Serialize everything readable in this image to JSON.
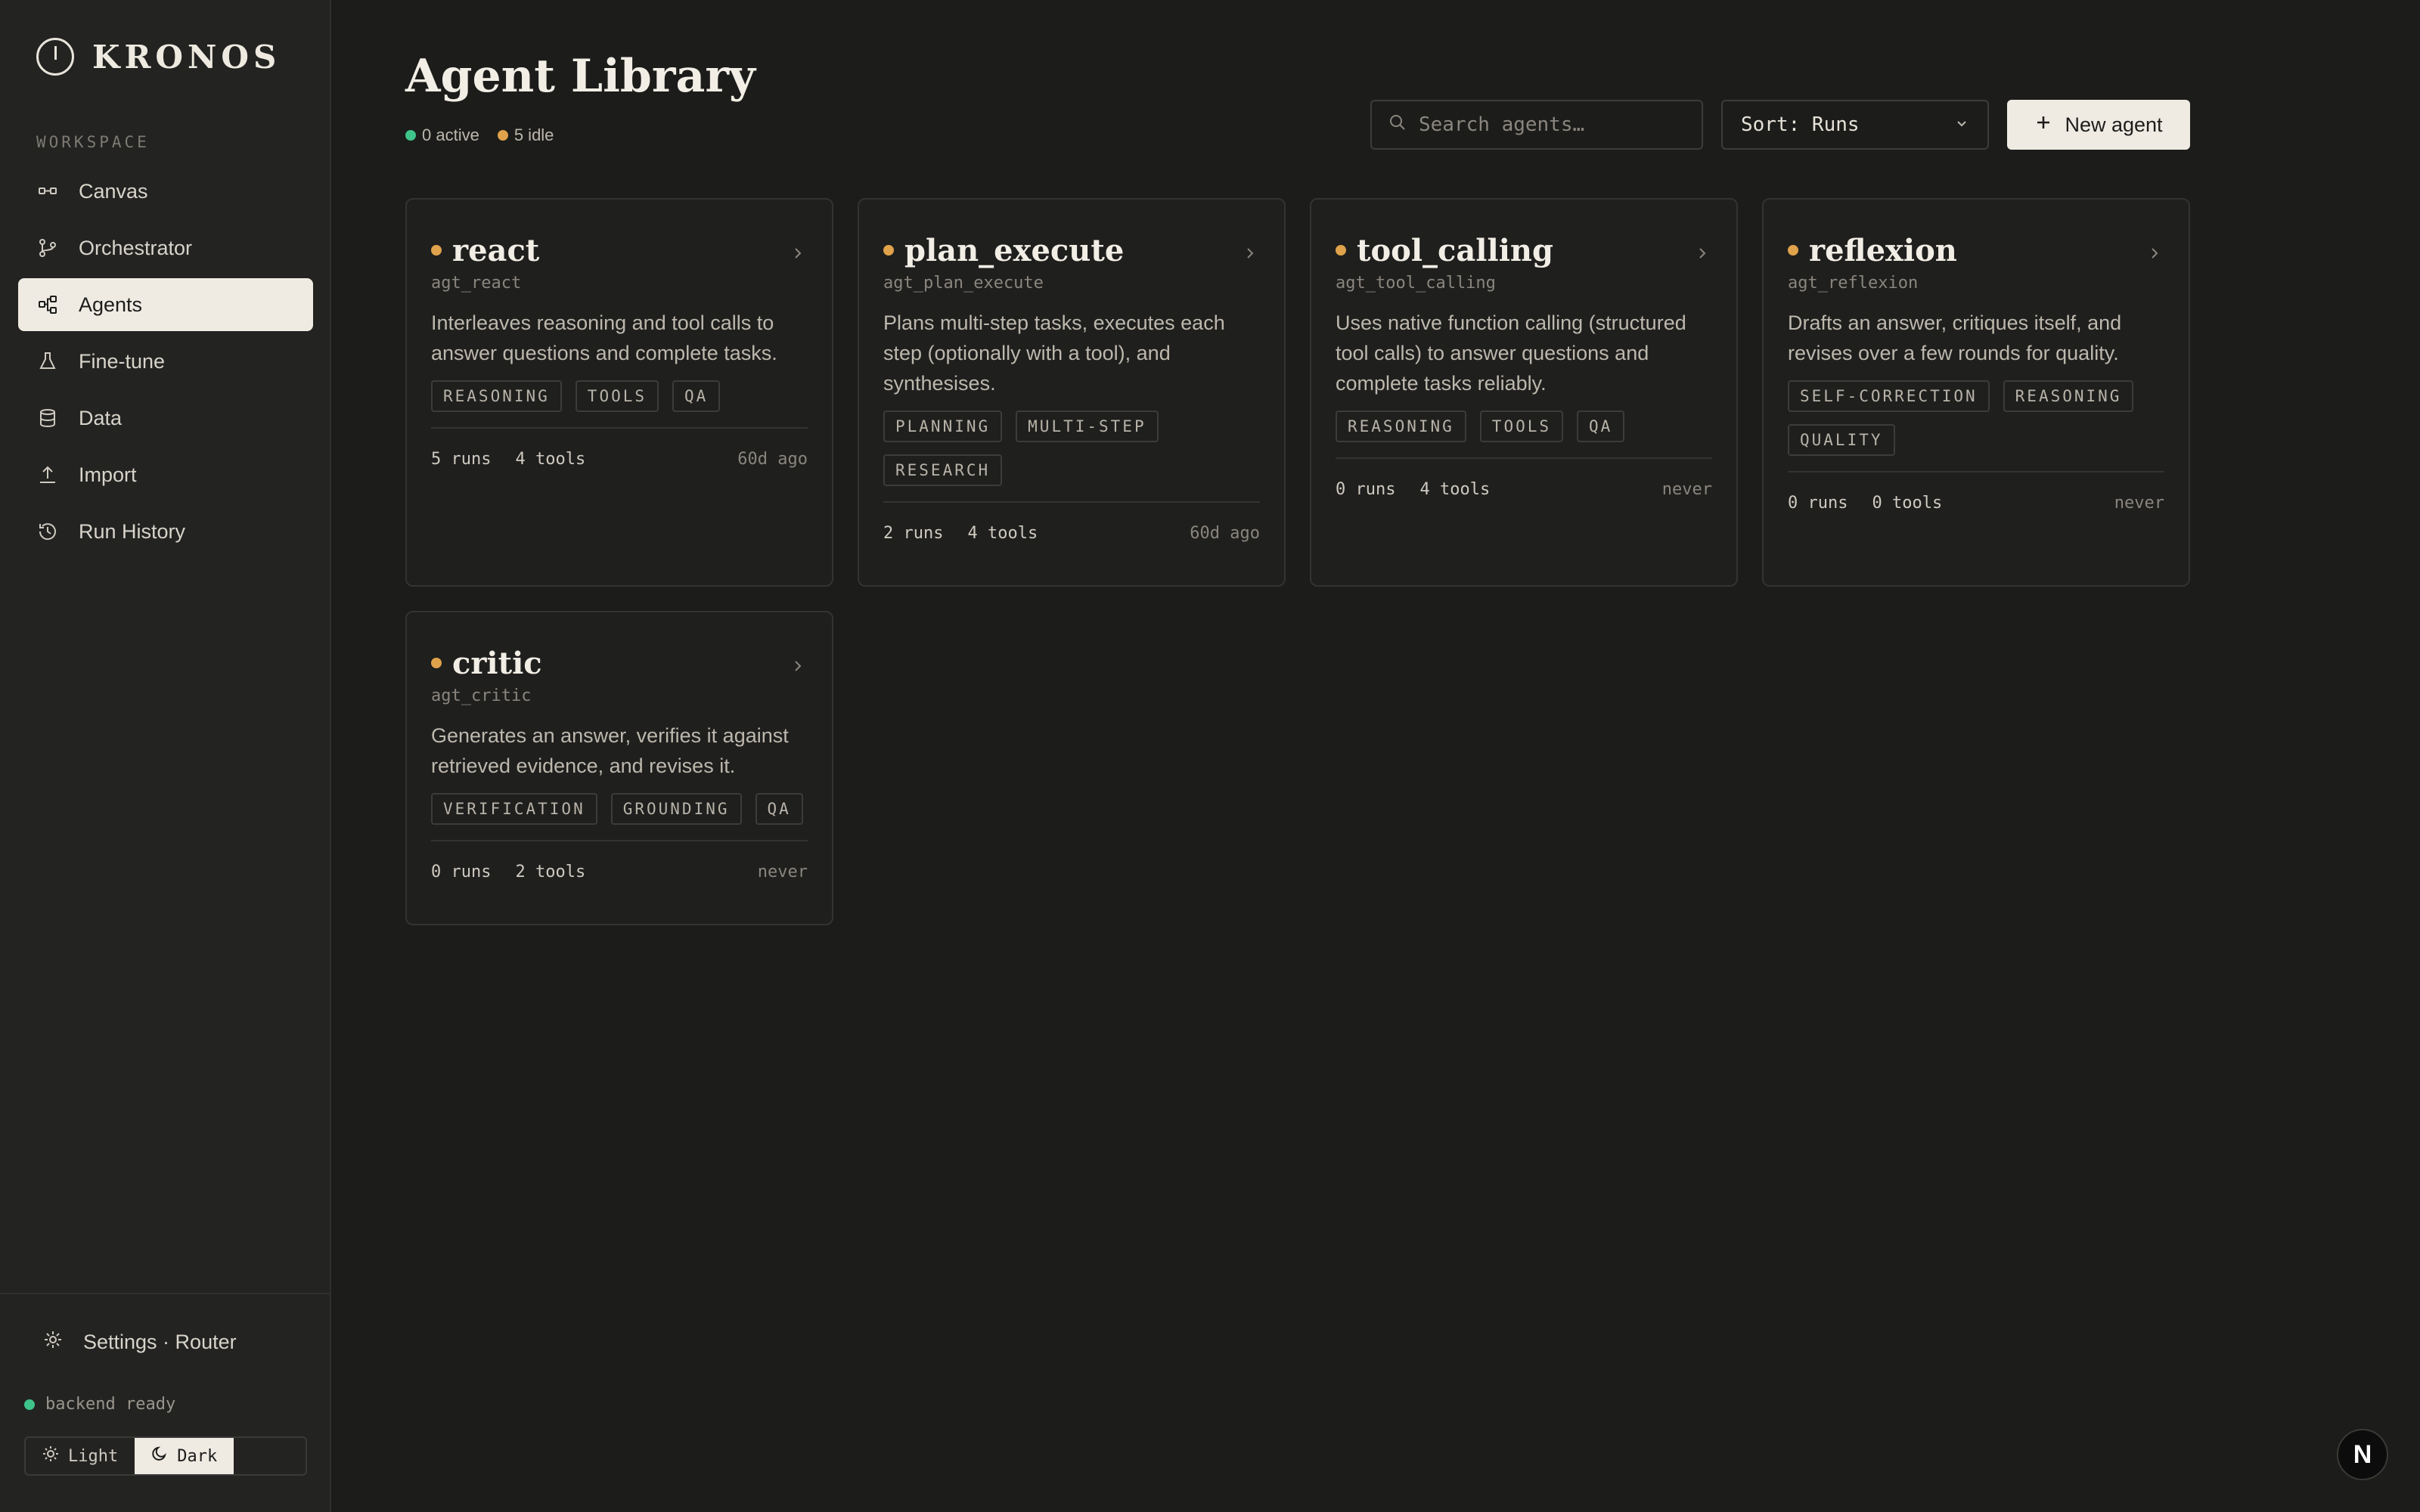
{
  "brand": {
    "name": "KRONOS"
  },
  "sidebar": {
    "section_label": "WORKSPACE",
    "items": [
      {
        "label": "Canvas",
        "icon": "canvas-icon",
        "active": false
      },
      {
        "label": "Orchestrator",
        "icon": "branch-icon",
        "active": false
      },
      {
        "label": "Agents",
        "icon": "agents-icon",
        "active": true
      },
      {
        "label": "Fine-tune",
        "icon": "flask-icon",
        "active": false
      },
      {
        "label": "Data",
        "icon": "database-icon",
        "active": false
      },
      {
        "label": "Import",
        "icon": "upload-icon",
        "active": false
      },
      {
        "label": "Run History",
        "icon": "history-icon",
        "active": false
      }
    ],
    "settings_label": "Settings · Router",
    "backend_status": "backend ready",
    "theme": {
      "light_label": "Light",
      "dark_label": "Dark",
      "selected": "Dark"
    }
  },
  "header": {
    "title": "Agent Library",
    "active_count": "0 active",
    "idle_count": "5 idle",
    "search_placeholder": "Search agents…",
    "sort_label": "Sort: Runs",
    "new_agent_label": "New agent"
  },
  "agents": [
    {
      "name": "react",
      "id": "agt_react",
      "description": "Interleaves reasoning and tool calls to answer questions and complete tasks.",
      "tags": [
        "REASONING",
        "TOOLS",
        "QA"
      ],
      "runs": "5 runs",
      "tools": "4 tools",
      "last_run": "60d ago"
    },
    {
      "name": "plan_execute",
      "id": "agt_plan_execute",
      "description": "Plans multi-step tasks, executes each step (optionally with a tool), and synthesises.",
      "tags": [
        "PLANNING",
        "MULTI-STEP",
        "RESEARCH"
      ],
      "runs": "2 runs",
      "tools": "4 tools",
      "last_run": "60d ago"
    },
    {
      "name": "tool_calling",
      "id": "agt_tool_calling",
      "description": "Uses native function calling (structured tool calls) to answer questions and complete tasks reliably.",
      "tags": [
        "REASONING",
        "TOOLS",
        "QA"
      ],
      "runs": "0 runs",
      "tools": "4 tools",
      "last_run": "never"
    },
    {
      "name": "reflexion",
      "id": "agt_reflexion",
      "description": "Drafts an answer, critiques itself, and revises over a few rounds for quality.",
      "tags": [
        "SELF-CORRECTION",
        "REASONING",
        "QUALITY"
      ],
      "runs": "0 runs",
      "tools": "0 tools",
      "last_run": "never"
    },
    {
      "name": "critic",
      "id": "agt_critic",
      "description": "Generates an answer, verifies it against retrieved evidence, and revises it.",
      "tags": [
        "VERIFICATION",
        "GROUNDING",
        "QA"
      ],
      "runs": "0 runs",
      "tools": "2 tools",
      "last_run": "never"
    }
  ],
  "fab_label": "N",
  "colors": {
    "background": "#1c1c1b",
    "sidebar": "#232322",
    "accent_light": "#efebe2",
    "status_active": "#3ec48a",
    "status_idle": "#e0a24a"
  }
}
